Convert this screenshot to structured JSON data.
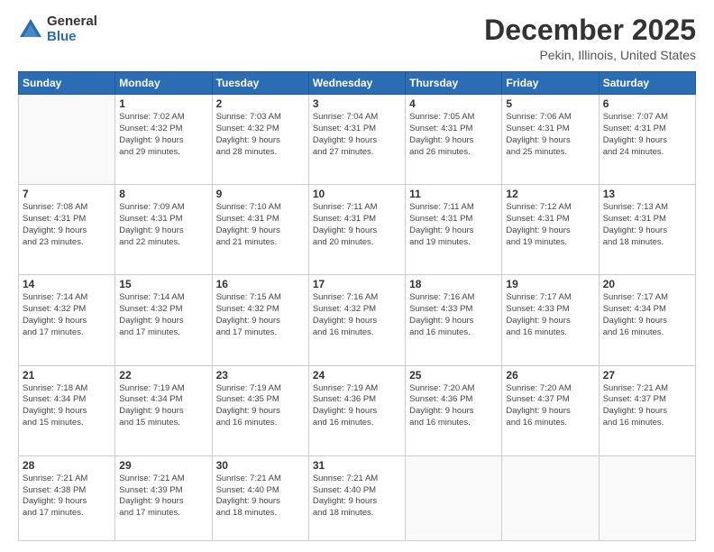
{
  "logo": {
    "general": "General",
    "blue": "Blue"
  },
  "header": {
    "month": "December 2025",
    "location": "Pekin, Illinois, United States"
  },
  "days_of_week": [
    "Sunday",
    "Monday",
    "Tuesday",
    "Wednesday",
    "Thursday",
    "Friday",
    "Saturday"
  ],
  "weeks": [
    [
      {
        "day": "",
        "info": []
      },
      {
        "day": "1",
        "info": [
          "Sunrise: 7:02 AM",
          "Sunset: 4:32 PM",
          "Daylight: 9 hours",
          "and 29 minutes."
        ]
      },
      {
        "day": "2",
        "info": [
          "Sunrise: 7:03 AM",
          "Sunset: 4:32 PM",
          "Daylight: 9 hours",
          "and 28 minutes."
        ]
      },
      {
        "day": "3",
        "info": [
          "Sunrise: 7:04 AM",
          "Sunset: 4:31 PM",
          "Daylight: 9 hours",
          "and 27 minutes."
        ]
      },
      {
        "day": "4",
        "info": [
          "Sunrise: 7:05 AM",
          "Sunset: 4:31 PM",
          "Daylight: 9 hours",
          "and 26 minutes."
        ]
      },
      {
        "day": "5",
        "info": [
          "Sunrise: 7:06 AM",
          "Sunset: 4:31 PM",
          "Daylight: 9 hours",
          "and 25 minutes."
        ]
      },
      {
        "day": "6",
        "info": [
          "Sunrise: 7:07 AM",
          "Sunset: 4:31 PM",
          "Daylight: 9 hours",
          "and 24 minutes."
        ]
      }
    ],
    [
      {
        "day": "7",
        "info": [
          "Sunrise: 7:08 AM",
          "Sunset: 4:31 PM",
          "Daylight: 9 hours",
          "and 23 minutes."
        ]
      },
      {
        "day": "8",
        "info": [
          "Sunrise: 7:09 AM",
          "Sunset: 4:31 PM",
          "Daylight: 9 hours",
          "and 22 minutes."
        ]
      },
      {
        "day": "9",
        "info": [
          "Sunrise: 7:10 AM",
          "Sunset: 4:31 PM",
          "Daylight: 9 hours",
          "and 21 minutes."
        ]
      },
      {
        "day": "10",
        "info": [
          "Sunrise: 7:11 AM",
          "Sunset: 4:31 PM",
          "Daylight: 9 hours",
          "and 20 minutes."
        ]
      },
      {
        "day": "11",
        "info": [
          "Sunrise: 7:11 AM",
          "Sunset: 4:31 PM",
          "Daylight: 9 hours",
          "and 19 minutes."
        ]
      },
      {
        "day": "12",
        "info": [
          "Sunrise: 7:12 AM",
          "Sunset: 4:31 PM",
          "Daylight: 9 hours",
          "and 19 minutes."
        ]
      },
      {
        "day": "13",
        "info": [
          "Sunrise: 7:13 AM",
          "Sunset: 4:31 PM",
          "Daylight: 9 hours",
          "and 18 minutes."
        ]
      }
    ],
    [
      {
        "day": "14",
        "info": [
          "Sunrise: 7:14 AM",
          "Sunset: 4:32 PM",
          "Daylight: 9 hours",
          "and 17 minutes."
        ]
      },
      {
        "day": "15",
        "info": [
          "Sunrise: 7:14 AM",
          "Sunset: 4:32 PM",
          "Daylight: 9 hours",
          "and 17 minutes."
        ]
      },
      {
        "day": "16",
        "info": [
          "Sunrise: 7:15 AM",
          "Sunset: 4:32 PM",
          "Daylight: 9 hours",
          "and 17 minutes."
        ]
      },
      {
        "day": "17",
        "info": [
          "Sunrise: 7:16 AM",
          "Sunset: 4:32 PM",
          "Daylight: 9 hours",
          "and 16 minutes."
        ]
      },
      {
        "day": "18",
        "info": [
          "Sunrise: 7:16 AM",
          "Sunset: 4:33 PM",
          "Daylight: 9 hours",
          "and 16 minutes."
        ]
      },
      {
        "day": "19",
        "info": [
          "Sunrise: 7:17 AM",
          "Sunset: 4:33 PM",
          "Daylight: 9 hours",
          "and 16 minutes."
        ]
      },
      {
        "day": "20",
        "info": [
          "Sunrise: 7:17 AM",
          "Sunset: 4:34 PM",
          "Daylight: 9 hours",
          "and 16 minutes."
        ]
      }
    ],
    [
      {
        "day": "21",
        "info": [
          "Sunrise: 7:18 AM",
          "Sunset: 4:34 PM",
          "Daylight: 9 hours",
          "and 15 minutes."
        ]
      },
      {
        "day": "22",
        "info": [
          "Sunrise: 7:19 AM",
          "Sunset: 4:34 PM",
          "Daylight: 9 hours",
          "and 15 minutes."
        ]
      },
      {
        "day": "23",
        "info": [
          "Sunrise: 7:19 AM",
          "Sunset: 4:35 PM",
          "Daylight: 9 hours",
          "and 16 minutes."
        ]
      },
      {
        "day": "24",
        "info": [
          "Sunrise: 7:19 AM",
          "Sunset: 4:36 PM",
          "Daylight: 9 hours",
          "and 16 minutes."
        ]
      },
      {
        "day": "25",
        "info": [
          "Sunrise: 7:20 AM",
          "Sunset: 4:36 PM",
          "Daylight: 9 hours",
          "and 16 minutes."
        ]
      },
      {
        "day": "26",
        "info": [
          "Sunrise: 7:20 AM",
          "Sunset: 4:37 PM",
          "Daylight: 9 hours",
          "and 16 minutes."
        ]
      },
      {
        "day": "27",
        "info": [
          "Sunrise: 7:21 AM",
          "Sunset: 4:37 PM",
          "Daylight: 9 hours",
          "and 16 minutes."
        ]
      }
    ],
    [
      {
        "day": "28",
        "info": [
          "Sunrise: 7:21 AM",
          "Sunset: 4:38 PM",
          "Daylight: 9 hours",
          "and 17 minutes."
        ]
      },
      {
        "day": "29",
        "info": [
          "Sunrise: 7:21 AM",
          "Sunset: 4:39 PM",
          "Daylight: 9 hours",
          "and 17 minutes."
        ]
      },
      {
        "day": "30",
        "info": [
          "Sunrise: 7:21 AM",
          "Sunset: 4:40 PM",
          "Daylight: 9 hours",
          "and 18 minutes."
        ]
      },
      {
        "day": "31",
        "info": [
          "Sunrise: 7:21 AM",
          "Sunset: 4:40 PM",
          "Daylight: 9 hours",
          "and 18 minutes."
        ]
      },
      {
        "day": "",
        "info": []
      },
      {
        "day": "",
        "info": []
      },
      {
        "day": "",
        "info": []
      }
    ]
  ]
}
